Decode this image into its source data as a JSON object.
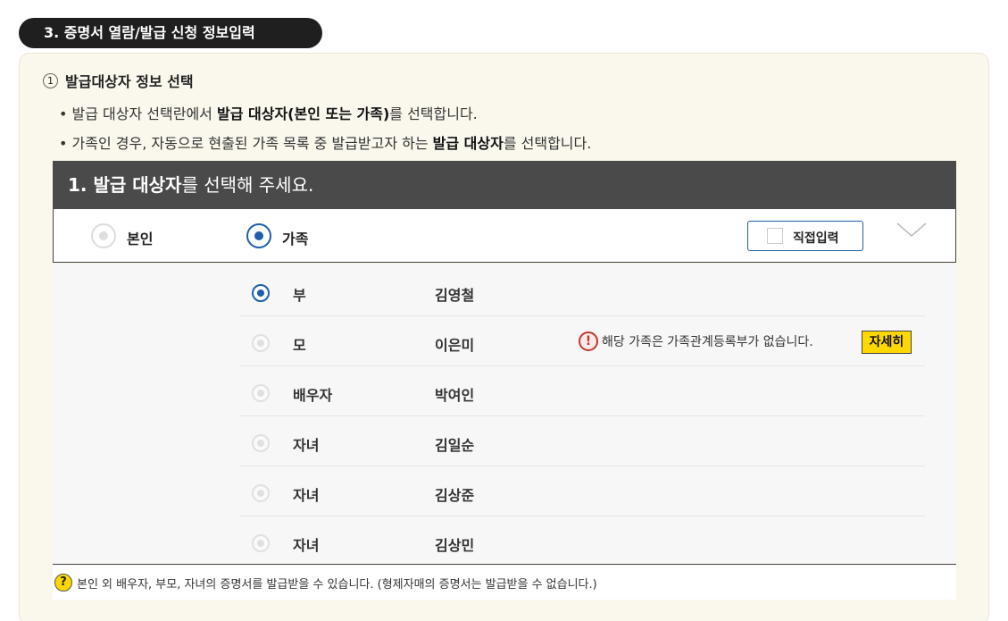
{
  "section": {
    "title": "3. 증명서 열람/발급 신청 정보입력"
  },
  "step": {
    "number": "1",
    "title": "발급대상자 정보 선택",
    "bullets": [
      {
        "pre": "발급 대상자 선택란에서 ",
        "bold": "발급 대상자(본인 또는 가족)",
        "post": "를 선택합니다."
      },
      {
        "pre": "가족인 경우, 자동으로 현출된 가족 목록 중 발급받고자 하는 ",
        "bold": "발급 대상자",
        "post": "를 선택합니다."
      }
    ]
  },
  "selector": {
    "header_bold": "1. 발급 대상자",
    "header_rest": "를 선택해 주세요.",
    "options": [
      {
        "label": "본인",
        "selected": false
      },
      {
        "label": "가족",
        "selected": true
      }
    ],
    "direct_input_label": "직접입력"
  },
  "family": [
    {
      "relation": "부",
      "name": "김영철",
      "selected": true,
      "warning": ""
    },
    {
      "relation": "모",
      "name": "이은미",
      "selected": false,
      "warning": "해당 가족은 가족관계등록부가 없습니다.",
      "detail_label": "자세히"
    },
    {
      "relation": "배우자",
      "name": "박여인",
      "selected": false,
      "warning": ""
    },
    {
      "relation": "자녀",
      "name": "김일순",
      "selected": false,
      "warning": ""
    },
    {
      "relation": "자녀",
      "name": "김상준",
      "selected": false,
      "warning": ""
    },
    {
      "relation": "자녀",
      "name": "김상민",
      "selected": false,
      "warning": ""
    }
  ],
  "footnote": "본인 외 배우자, 부모, 자녀의 증명서를 발급받을 수 있습니다. (형제자매의 증명서는 발급받을 수 없습니다.)",
  "colors": {
    "accent": "#1f5ea8",
    "highlight": "#ffd800",
    "panel_bg": "#faf7ec",
    "header_bg": "#4a4a4a"
  }
}
